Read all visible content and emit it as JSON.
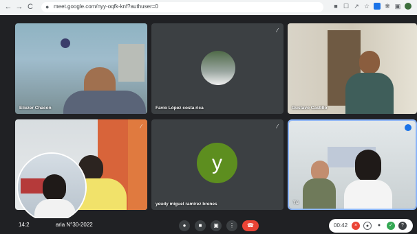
{
  "browser": {
    "url": "meet.google.com/nyy-oqfk-knf?authuser=0",
    "back_icon": "←",
    "forward_icon": "→",
    "reload_icon": "C",
    "lock_icon": "🔒"
  },
  "participants": [
    {
      "name": "Eliezer Chacon",
      "muted": false
    },
    {
      "name": "Favio López costa rica",
      "muted": true
    },
    {
      "name": "Gustavo Castillo",
      "muted": false
    },
    {
      "name": "",
      "muted": true
    },
    {
      "name": "yeudy miguel ramírez brenes",
      "muted": true,
      "initial": "y"
    },
    {
      "name": "Tú",
      "muted": false,
      "speaking": true
    }
  ],
  "colors": {
    "stage": "#202124",
    "tile": "#3c4043",
    "end_call": "#ea4335",
    "avatar_y": "#5d8e1f",
    "speaking_outline": "#8ab4f8"
  },
  "meeting": {
    "time": "14:2",
    "title_fragment": "aria N°30-2022"
  },
  "recording": {
    "elapsed": "00:42"
  }
}
